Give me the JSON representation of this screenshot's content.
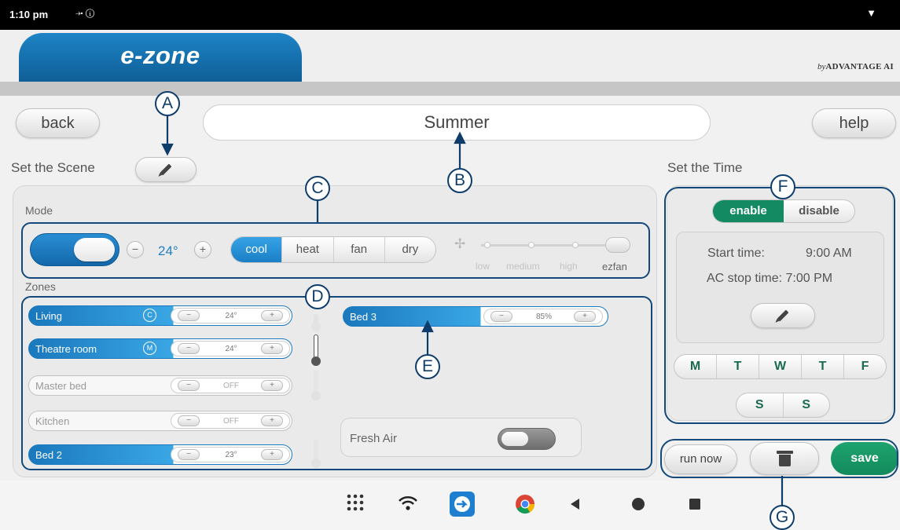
{
  "status_bar": {
    "time": "1:10 pm",
    "icons": "⤞ ⓘ",
    "wifi": "▼"
  },
  "header": {
    "brand": "e-zone",
    "byline_prefix": "by",
    "byline_brand": "ADVANTAGE AI"
  },
  "toolbar": {
    "back_label": "back",
    "scene_name": "Summer",
    "help_label": "help"
  },
  "scene": {
    "title": "Set the Scene",
    "mode_label": "Mode",
    "set_temp": "24°",
    "minus": "−",
    "plus": "+",
    "modes": [
      "cool",
      "heat",
      "fan",
      "dry"
    ],
    "selected_mode": "cool",
    "fan_speeds": [
      "low",
      "medium",
      "high",
      "ezfan"
    ],
    "selected_fan": "ezfan"
  },
  "zones": {
    "label": "Zones",
    "items": [
      {
        "name": "Living",
        "value": "24°",
        "on": true,
        "icon": "C"
      },
      {
        "name": "Theatre room",
        "value": "24°",
        "on": true,
        "icon": "M"
      },
      {
        "name": "Master bed",
        "value": "OFF",
        "on": false,
        "icon": ""
      },
      {
        "name": "Kitchen",
        "value": "OFF",
        "on": false,
        "icon": ""
      },
      {
        "name": "Bed 2",
        "value": "23°",
        "on": true,
        "icon": ""
      },
      {
        "name": "Bed 3",
        "value": "85%",
        "on": true,
        "icon": ""
      }
    ],
    "fresh_air_label": "Fresh Air"
  },
  "timer": {
    "title": "Set the Time",
    "enable": "enable",
    "disable": "disable",
    "start_label": "Start time:",
    "start_value": "9:00 AM",
    "stop_label": "AC stop time: 7:00 PM",
    "weekdays": [
      "M",
      "T",
      "W",
      "T",
      "F"
    ],
    "weekend": [
      "S",
      "S"
    ]
  },
  "actions": {
    "run_now": "run now",
    "save": "save"
  },
  "callouts": {
    "a": "A",
    "b": "B",
    "c": "C",
    "d": "D",
    "e": "E",
    "f": "F",
    "g": "G"
  },
  "colors": {
    "accent_blue": "#1b7fc6",
    "brand_green": "#138a5b",
    "callout_navy": "#0e3d6b"
  }
}
